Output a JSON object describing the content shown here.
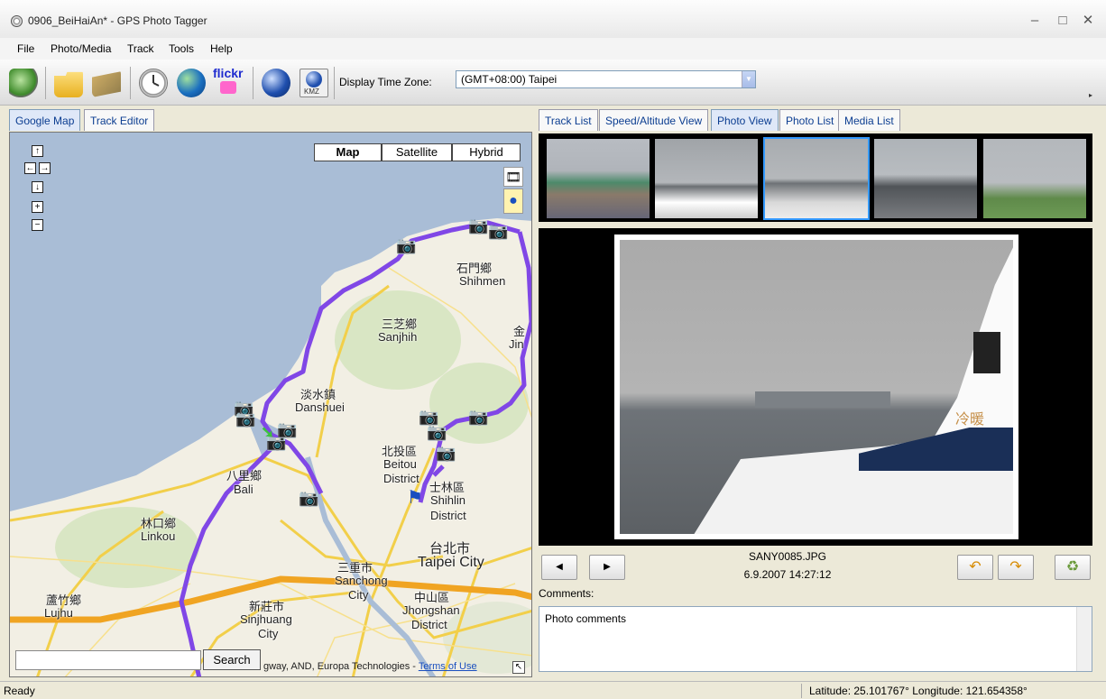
{
  "window": {
    "title": "0906_BeiHaiAn* - GPS Photo Tagger",
    "minimize": "–",
    "maximize": "□",
    "close": "✕"
  },
  "menu": {
    "items": [
      "File",
      "Photo/Media",
      "Track",
      "Tools",
      "Help"
    ]
  },
  "toolbar": {
    "flickr": "flickr",
    "kmz": "KMZ",
    "timezone_label": "Display Time Zone:",
    "timezone_value": "(GMT+08:00) Taipei"
  },
  "left_tabs": [
    "Google Map",
    "Track Editor"
  ],
  "map": {
    "types": [
      "Map",
      "Satellite",
      "Hybrid"
    ],
    "search_button": "Search",
    "search_placeholder": "",
    "attribution": "gway, AND, Europa Technologies -",
    "terms": "Terms of Use",
    "places": [
      "石門鄉",
      "Shihmen",
      "三芝鄉",
      "Sanjhih",
      "淡水鎮",
      "Danshuei",
      "北投區",
      "Beitou",
      "District",
      "士林區",
      "Shihlin",
      "District",
      "八里鄉",
      "Bali",
      "林口鄉",
      "Linkou",
      "台北市",
      "Taipei City",
      "三重市",
      "Sanchong",
      "City",
      "新莊市",
      "Sinjhuang",
      "City",
      "中山區",
      "Jhongshan",
      "District",
      "蘆竹鄉",
      "Lujhu",
      "金",
      "Jin"
    ]
  },
  "right_tabs": [
    "Track List",
    "Speed/Altitude View",
    "Photo View",
    "Photo List",
    "Media List"
  ],
  "photo": {
    "filename": "SANY0085.JPG",
    "datetime": "6.9.2007 14:27:12",
    "comments_label": "Comments:",
    "comments": "Photo comments",
    "boat_text": "冷暖"
  },
  "status": {
    "left": "Ready",
    "right": "Latitude: 25.101767°  Longitude: 121.654358°"
  }
}
